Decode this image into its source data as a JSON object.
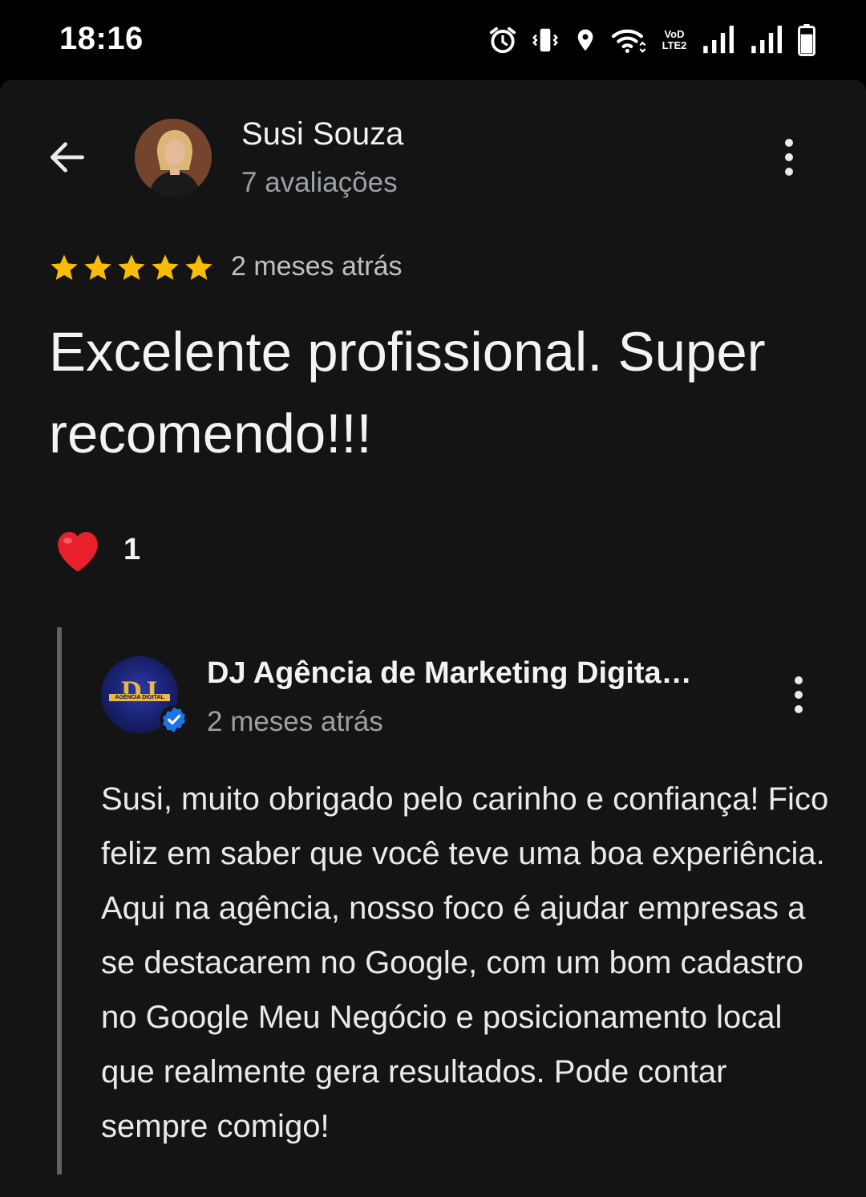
{
  "status_bar": {
    "time": "18:16",
    "icons": [
      "alarm-icon",
      "vibrate-icon",
      "location-icon",
      "wifi-icon",
      "volte-icon",
      "signal-icon",
      "signal-icon",
      "battery-icon"
    ],
    "volte_line1": "VoD",
    "volte_line2": "LTE2"
  },
  "header": {
    "back_icon": "arrow-back-icon",
    "reviewer_name": "Susi Souza",
    "reviewer_reviews": "7 avaliações",
    "more_icon": "more-vert-icon"
  },
  "review": {
    "rating": 5,
    "max_rating": 5,
    "star_color": "#fbbc04",
    "date": "2 meses atrás",
    "text": "Excelente profissional. Super recomendo!!!",
    "reaction_emoji": "heart",
    "reaction_count": "1"
  },
  "owner_reply": {
    "name": "DJ Agência de Marketing Digita…",
    "logo_text": "DJ",
    "logo_subtext": "AGÊNCIA DIGITAL",
    "verified": true,
    "verified_color": "#1a73e8",
    "date": "2 meses atrás",
    "text": "Susi, muito obrigado pelo carinho e confiança! Fico feliz em saber que você teve uma boa experiência. Aqui na agência, nosso foco é ajudar empresas a se destacarem no Google, com um bom cadastro no Google Meu Negócio e posicionamento local que realmente gera resultados. Pode contar sempre comigo!"
  }
}
